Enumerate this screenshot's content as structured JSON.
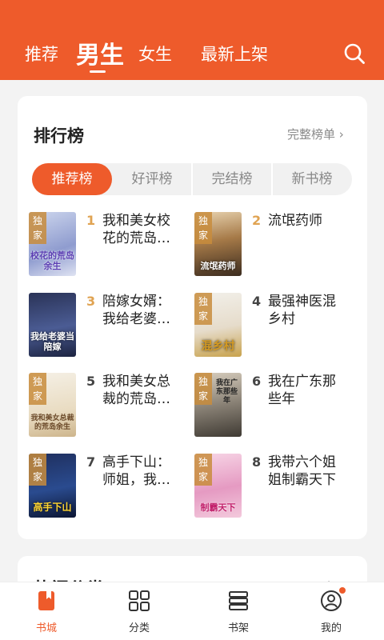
{
  "header": {
    "tabs": [
      {
        "label": "推荐"
      },
      {
        "label": "男生"
      },
      {
        "label": "女生"
      },
      {
        "label": "最新上架"
      }
    ],
    "active_tab": "男生",
    "search_icon": "search-icon"
  },
  "ranking": {
    "title": "排行榜",
    "full_list": "完整榜单 ›",
    "segments": [
      "推荐榜",
      "好评榜",
      "完结榜",
      "新书榜"
    ],
    "active_segment": "推荐榜",
    "books": [
      {
        "rank": "1",
        "title": "我和美女校花的荒岛…",
        "tag": "独家",
        "cover_text": "校花的荒岛余生"
      },
      {
        "rank": "2",
        "title": "流氓药师",
        "tag": "独家",
        "cover_text": "流氓药师"
      },
      {
        "rank": "3",
        "title": "陪嫁女婿：我给老婆…",
        "tag": "",
        "cover_text": "我给老婆当陪嫁"
      },
      {
        "rank": "4",
        "title": "最强神医混乡村",
        "tag": "独家",
        "cover_text": "混乡村"
      },
      {
        "rank": "5",
        "title": "我和美女总裁的荒岛…",
        "tag": "独家",
        "cover_text": "我和美女总裁的荒岛余生"
      },
      {
        "rank": "6",
        "title": "我在广东那些年",
        "tag": "独家",
        "cover_text": "我在广东那些年"
      },
      {
        "rank": "7",
        "title": "高手下山：师姐，我…",
        "tag": "独家",
        "cover_text": "高手下山"
      },
      {
        "rank": "8",
        "title": "我带六个姐姐制霸天下",
        "tag": "独家",
        "cover_text": "制霸天下"
      }
    ]
  },
  "section2": {
    "title": "热门分类",
    "more": "更多"
  },
  "nav": [
    {
      "label": "书城",
      "icon": "bookstore-icon"
    },
    {
      "label": "分类",
      "icon": "category-grid-icon"
    },
    {
      "label": "书架",
      "icon": "bookshelf-icon"
    },
    {
      "label": "我的",
      "icon": "profile-icon"
    }
  ],
  "colors": {
    "accent": "#ee5b2b",
    "rank_top": "#e0a352",
    "rank_other": "#444444"
  }
}
